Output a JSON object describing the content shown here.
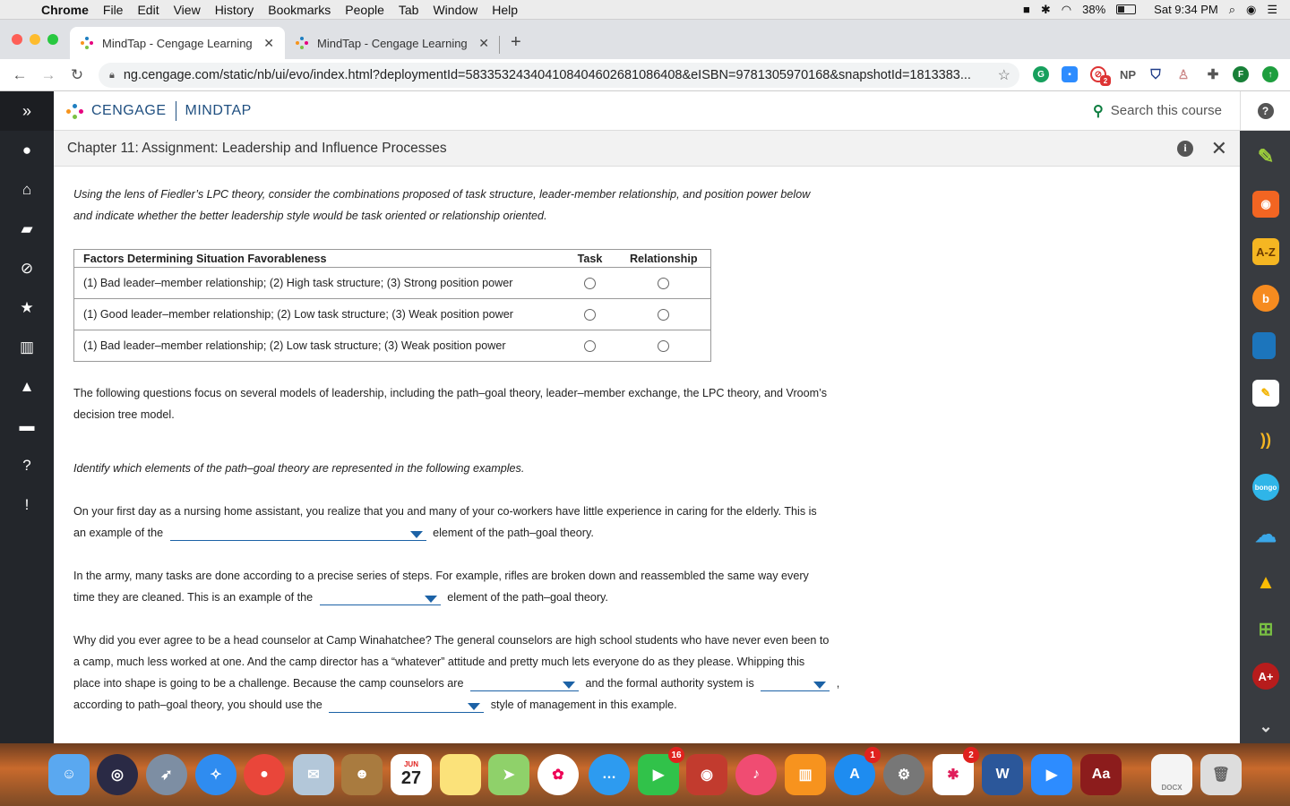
{
  "menubar": {
    "app": "Chrome",
    "items": [
      "File",
      "Edit",
      "View",
      "History",
      "Bookmarks",
      "People",
      "Tab",
      "Window",
      "Help"
    ],
    "battery": "38%",
    "clock": "Sat 9:34 PM"
  },
  "tabs": [
    {
      "title": "MindTap - Cengage Learning",
      "active": true
    },
    {
      "title": "MindTap - Cengage Learning",
      "active": false
    }
  ],
  "address": {
    "url": "ng.cengage.com/static/nb/ui/evo/index.html?deploymentId=583353243404108404602681086408&eISBN=9781305970168&snapshotId=1813383..."
  },
  "extensions": {
    "np": "NP",
    "badge_count": "2",
    "profile": "F"
  },
  "brand": {
    "left": "CENGAGE",
    "right": "MINDTAP"
  },
  "search": {
    "placeholder": "Search this course"
  },
  "chapter": {
    "title": "Chapter 11: Assignment: Leadership and Influence Processes"
  },
  "content": {
    "intro_line1": "Using the lens of Fiedler’s LPC theory, consider the combinations proposed of task structure, leader-member relationship, and position power below",
    "intro_line2": "and indicate whether the better leadership style would be task oriented or relationship oriented.",
    "table": {
      "headers": [
        "Factors Determining Situation Favorableness",
        "Task",
        "Relationship"
      ],
      "rows": [
        "(1) Bad leader–member relationship; (2) High task structure; (3) Strong position power",
        "(1) Good leader–member relationship; (2) Low task structure; (3) Weak position power",
        "(1) Bad leader–member relationship; (2) Low task structure; (3) Weak position power"
      ]
    },
    "models_line1": "The following questions focus on several models of leadership, including the path–goal theory, leader–member exchange, the LPC theory, and Vroom’s",
    "models_line2": "decision tree model.",
    "identify": "Identify which elements of the path–goal theory are represented in the following examples.",
    "q1_line1": "On your first day as a nursing home assistant, you realize that you and many of your co-workers have little experience in caring for the elderly. This is",
    "q1_pre": "an example of the",
    "q1_post": "element of the path–goal theory.",
    "q2_line1": "In the army, many tasks are done according to a precise series of steps. For example, rifles are broken down and reassembled the same way every",
    "q2_pre": "time they are cleaned. This is an example of the",
    "q2_post": "element of the path–goal theory.",
    "q3_line1": "Why did you ever agree to be a head counselor at Camp Winahatchee? The general counselors are high school students who have never even been to",
    "q3_line2": "a camp, much less worked at one. And the camp director has a “whatever” attitude and pretty much lets everyone do as they please. Whipping this",
    "q3_pre": "place into shape is going to be a challenge. Because the camp counselors are",
    "q3_mid": "and the formal authority system is",
    "q3_comma": ",",
    "q3_pre2": "according to path–goal theory, you should use the",
    "q3_post2": "style of management in this example."
  },
  "rightbar": {
    "az": "A-Z",
    "bongo": "bongo"
  },
  "dock": {
    "calendar_month": "JUN",
    "calendar_day": "27",
    "facetime_badge": "16",
    "appstore_badge": "1",
    "slack_badge": "2",
    "dictionary": "Aa",
    "docx": "DOCX"
  }
}
